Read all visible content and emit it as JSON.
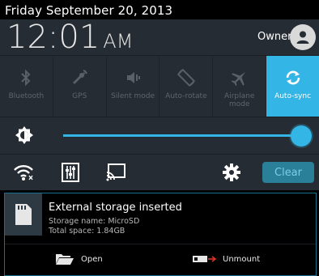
{
  "status_bar": {
    "date": "Friday September 20, 2013"
  },
  "header": {
    "time": "12:01",
    "ampm": "AM",
    "user": "Owner"
  },
  "quick_settings": {
    "toggles": [
      {
        "label": "Bluetooth",
        "icon": "bluetooth-icon",
        "active": false
      },
      {
        "label": "GPS",
        "icon": "gps-icon",
        "active": false
      },
      {
        "label": "Silent mode",
        "icon": "silent-mode-icon",
        "active": false
      },
      {
        "label": "Auto-rotate",
        "icon": "auto-rotate-icon",
        "active": false
      },
      {
        "label": "Airplane mode",
        "icon": "airplane-icon",
        "active": false
      },
      {
        "label": "Auto-sync",
        "icon": "sync-icon",
        "active": true
      }
    ],
    "brightness_level": 1.0,
    "clear_label": "Clear"
  },
  "notification": {
    "title": "External storage inserted",
    "line1": "Storage name: MicroSD",
    "line2": "Total space: 1.84GB",
    "open_label": "Open",
    "unmount_label": "Unmount"
  },
  "colors": {
    "accent": "#33b5e5",
    "panel": "#262c33",
    "inactive": "#5a6068"
  }
}
